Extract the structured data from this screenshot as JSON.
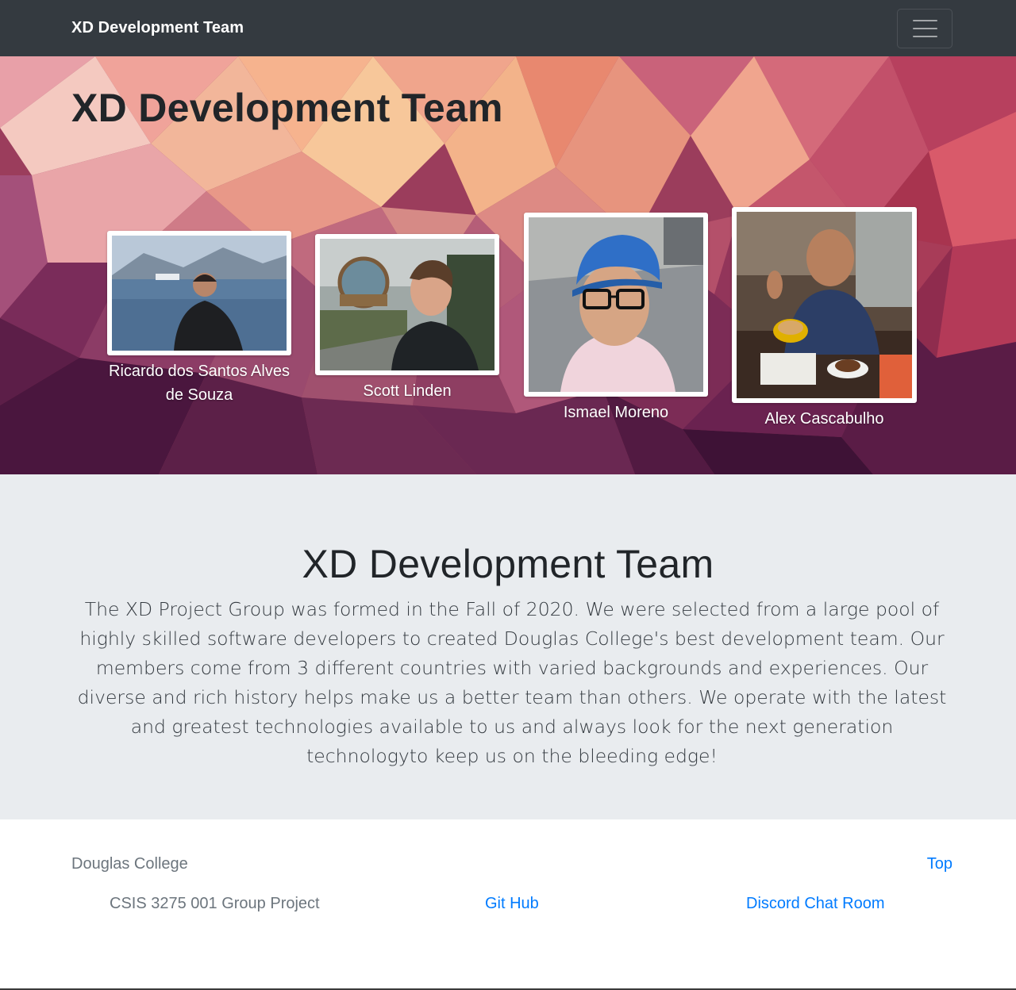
{
  "navbar": {
    "brand": "XD Development Team",
    "toggler_icon": "hamburger-menu-icon"
  },
  "hero": {
    "title": "XD Development Team",
    "members": [
      {
        "name": "Ricardo dos Santos Alves de Souza"
      },
      {
        "name": "Scott Linden"
      },
      {
        "name": "Ismael Moreno"
      },
      {
        "name": "Alex Cascabulho"
      }
    ]
  },
  "about": {
    "title": "XD Development Team",
    "text": "The XD Project Group was formed in the Fall of 2020. We were selected from a large pool of highly skilled software developers to created Douglas College's best development team. Our members come from 3 different countries with varied backgrounds and experiences. Our diverse and rich history helps make us a better team than others. We operate with the latest and greatest technologies available to us and always look for the next generation technologyto keep us on the bleeding edge!"
  },
  "footer": {
    "college": "Douglas College",
    "top_link": "Top",
    "course": "CSIS 3275 001 Group Project",
    "github_link": "Git Hub",
    "discord_link": "Discord Chat Room"
  },
  "colors": {
    "navbar_bg": "#343a40",
    "about_bg": "#e9ecef",
    "link": "#007bff",
    "muted": "#6c757d"
  }
}
